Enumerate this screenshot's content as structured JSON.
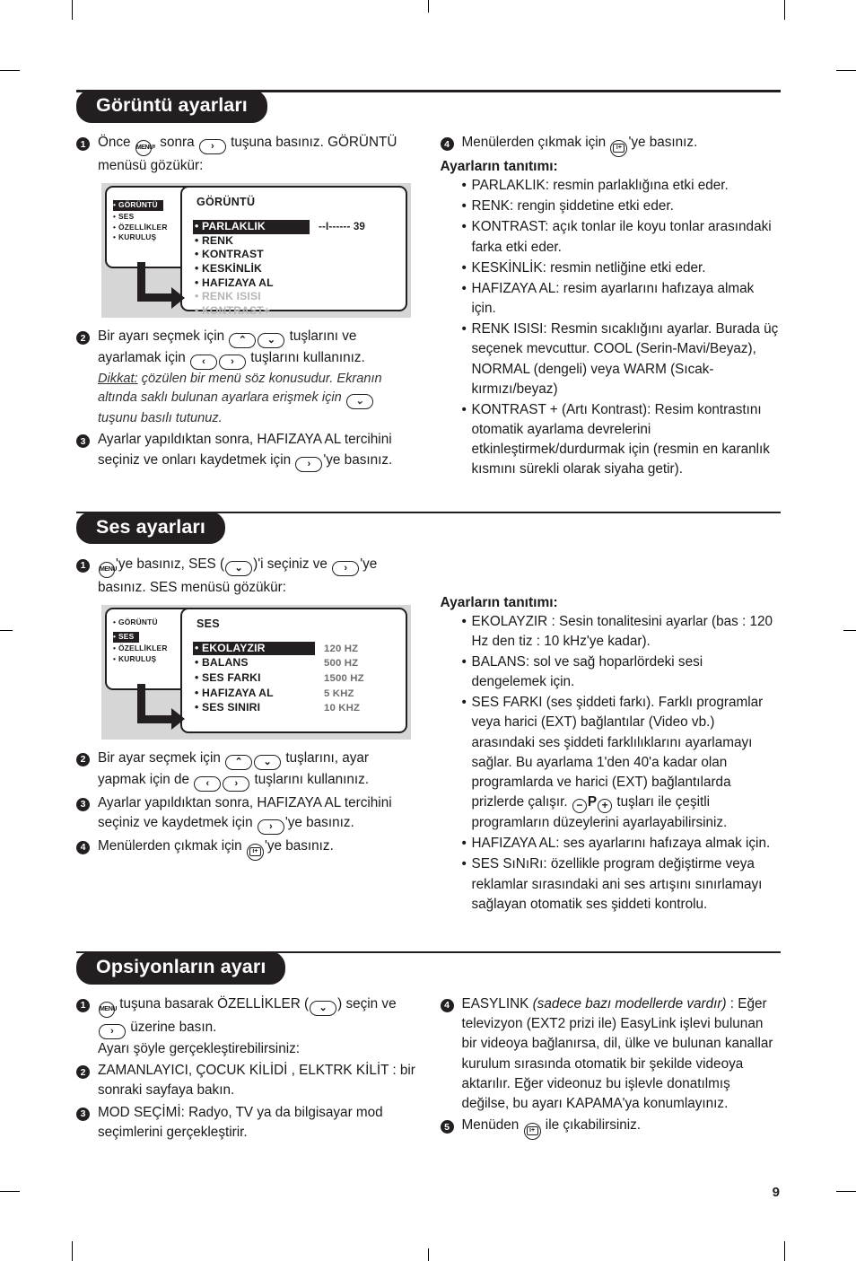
{
  "page": {
    "number": "9"
  },
  "sections": [
    {
      "title": "Görüntü ayarları",
      "left": {
        "steps": [
          {
            "num": "1",
            "text_a": "Önce ",
            "key1": "MENU",
            "text_b": ", sonra ",
            "key2": "›",
            "text_c": " tuşuna basınız. GÖRÜNTÜ menüsü gözükür:"
          }
        ],
        "figure": {
          "menu_list": [
            "GÖRÜNTÜ",
            "SES",
            "ÖZELLİKLER",
            "KURULUŞ"
          ],
          "menu_selected": "GÖRÜNTÜ",
          "panel_title": "GÖRÜNTÜ",
          "rows": [
            {
              "label": "PARLAKLIK",
              "value": "--I------ 39",
              "state": "selected"
            },
            {
              "label": "RENK",
              "value": "",
              "state": "normal"
            },
            {
              "label": "KONTRAST",
              "value": "",
              "state": "normal"
            },
            {
              "label": "KESKİNLİK",
              "value": "",
              "state": "normal"
            },
            {
              "label": "HAFIZAYA AL",
              "value": "",
              "state": "normal"
            },
            {
              "label": "RENK ISISI",
              "value": "",
              "state": "dim"
            },
            {
              "label": "KONTRAST+",
              "value": "",
              "state": "dim"
            }
          ]
        },
        "step2_a": "Bir ayarı seçmek için ",
        "step2_b": " tuşlarını ve ayarlamak için ",
        "step2_c": " tuşlarını kullanınız.",
        "note_label": "Dikkat:",
        "note_a": " çözülen bir menü söz konusudur. Ekranın altında saklı bulunan ayarlara erişmek için ",
        "note_b": " tuşunu basılı tutunuz.",
        "step3_a": "Ayarlar yapıldıktan sonra, HAFIZAYA AL tercihini seçiniz ve onları kaydetmek için ",
        "step3_b": "'ye basınız."
      },
      "right": {
        "step4_a": "Menülerden çıkmak için ",
        "step4_b": "'ye basınız.",
        "heading": "Ayarların tanıtımı:",
        "items": [
          "PARLAKLIK: resmin parlaklığına etki eder.",
          "RENK: rengin şiddetine etki eder.",
          "KONTRAST: açık tonlar ile koyu tonlar arasındaki farka etki eder.",
          "KESKİNLİK: resmin netliğine etki eder.",
          "HAFIZAYA AL: resim ayarlarını hafızaya almak için.",
          "RENK ISISI: Resmin sıcaklığını ayarlar. Burada üç seçenek mevcuttur. COOL (Serin-Mavi/Beyaz), NORMAL (dengeli) veya WARM (Sıcak-kırmızı/beyaz)",
          "KONTRAST + (Artı Kontrast): Resim kontrastını otomatik ayarlama devrelerini etkinleştirmek/durdurmak için (resmin en karanlık kısmını sürekli olarak siyaha getir)."
        ]
      }
    },
    {
      "title": "Ses ayarları",
      "left": {
        "step1_a": "'ye basınız, SES (",
        "step1_b": ")'i seçiniz ve ",
        "step1_c": "'ye basınız. SES menüsü gözükür:",
        "figure": {
          "menu_list": [
            "GÖRÜNTÜ",
            "SES",
            "ÖZELLİKLER",
            "KURULUŞ"
          ],
          "menu_selected": "SES",
          "panel_title": "SES",
          "rows": [
            {
              "label": "EKOLAYZIR",
              "value": "120 HZ",
              "state": "selected"
            },
            {
              "label": "BALANS",
              "value": "500 HZ",
              "state": "normal"
            },
            {
              "label": "SES FARKI",
              "value": "1500 HZ",
              "state": "normal"
            },
            {
              "label": "HAFIZAYA AL",
              "value": "5 KHZ",
              "state": "normal"
            },
            {
              "label": "SES SINIRI",
              "value": "10 KHZ",
              "state": "normal"
            }
          ]
        },
        "step2_a": "Bir ayar seçmek için ",
        "step2_b": " tuşlarını, ayar yapmak için de ",
        "step2_c": " tuşlarını kullanınız.",
        "step3_a": "Ayarlar yapıldıktan sonra, HAFIZAYA AL tercihini seçiniz ve kaydetmek için ",
        "step3_b": "'ye basınız.",
        "step4_a": "Menülerden çıkmak için ",
        "step4_b": "'ye basınız."
      },
      "right": {
        "heading": "Ayarların tanıtımı:",
        "item1": "EKOLAYZIR : Sesin tonalitesini ayarlar (bas : 120 Hz den tiz : 10 kHz'ye kadar).",
        "item2": "BALANS: sol ve sağ hoparlördeki sesi dengelemek için.",
        "item3_a": "SES FARKI (ses şiddeti farkı). Farklı programlar veya harici (EXT) bağlantılar (Video vb.) arasındaki ses şiddeti farklılıklarını ayarlamayı sağlar. Bu ayarlama 1'den 40'a kadar olan programlarda ve harici (EXT) bağlantılarda prizlerde çalışır. ",
        "item3_b": " tuşları ile çeşitli programların düzeylerini ayarlayabilirsiniz.",
        "item3_keyminus": "−",
        "item3_keyp": "P",
        "item3_keyplus": "+",
        "item4": "HAFIZAYA AL: ses ayarlarını hafızaya almak için.",
        "item5": "SES SıNıRı: özellikle program değiştirme veya reklamlar sırasındaki ani ses artışını sınırlamayı sağlayan otomatik ses şiddeti kontrolu."
      }
    },
    {
      "title": "Opsiyonların ayarı",
      "left": {
        "step1_a": " tuşuna basarak ÖZELLİKLER (",
        "step1_b": ") seçin ve ",
        "step1_c": " üzerine basın.",
        "step1_d": "Ayarı şöyle gerçekleştirebilirsiniz:",
        "step2": "ZAMANLAYICI, ÇOCUK KİLİDİ , ELKTRK KİLİT : bir sonraki sayfaya bakın.",
        "step3": "MOD SEÇİMİ: Radyo, TV ya da bilgisayar mod seçimlerini gerçekleştirir."
      },
      "right": {
        "step4_name": "EASYLINK",
        "step4_italic": "(sadece bazı modellerde vardır)",
        "step4_colon": " : ",
        "step4_text": "Eğer televizyon (EXT2 prizi ile) EasyLink işlevi bulunan bir videoya bağlanırsa, dil, ülke ve bulunan kanallar kurulum sırasında otomatik bir şekilde videoya aktarılır. Eğer videonuz bu işlevle donatılmış değilse, bu ayarı KAPAMA'ya konumlayınız.",
        "step5_a": "Menüden ",
        "step5_b": " ile çıkabilirsiniz."
      }
    }
  ],
  "keys": {
    "menu": "MENU",
    "right": "›",
    "left": "‹",
    "up": "⌃",
    "down": "⌄",
    "exit": "i+",
    "minus": "−",
    "plus": "+",
    "p": "P"
  },
  "colors": {
    "ink": "#231f20",
    "figure_background": "#d6d6d6",
    "dim_text": "#b5b5b5",
    "value_text": "#6e6e6e"
  }
}
